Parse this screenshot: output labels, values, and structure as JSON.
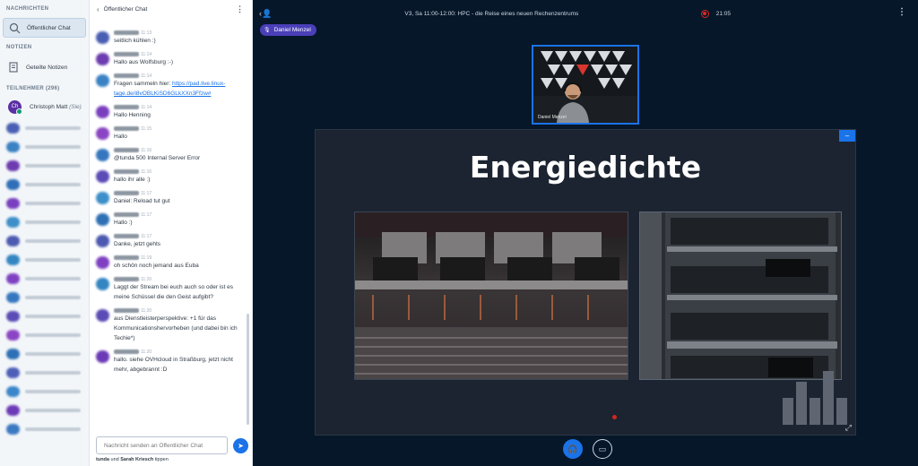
{
  "sidebar": {
    "messages_heading": "NACHRICHTEN",
    "public_chat": "Öffentlicher Chat",
    "notes_heading": "NOTIZEN",
    "shared_notes": "Geteilte Notizen",
    "participants_heading": "TEILNEHMER (296)",
    "me": {
      "initials": "Ch",
      "name": "Christoph Matt",
      "suffix": "(Sie)"
    },
    "blurred_colors": [
      "#4a5fb3",
      "#3a82c4",
      "#6c3cb0",
      "#2f6fb8",
      "#7a3fbf",
      "#3c8fc9",
      "#4b5ab0",
      "#3386c2",
      "#7f41c2",
      "#3577bf",
      "#5a4bb6",
      "#8a45c4",
      "#2e70b5",
      "#4e5fb8",
      "#3a86c9",
      "#6b3ab6",
      "#3b79c0"
    ]
  },
  "chat": {
    "title": "Öffentlicher Chat",
    "input_placeholder": "Nachricht senden an Öffentlicher Chat",
    "typing_user1": "tunda",
    "typing_and": "und",
    "typing_user2": "Sarah Kriesch",
    "typing_suffix": "tippen",
    "messages": [
      {
        "time": "11:13",
        "text": "seitlich kühlen :)",
        "color": "#4a5fb3"
      },
      {
        "time": "11:14",
        "text": "Hallo aus Wolfsburg :-)",
        "color": "#6c3cb0"
      },
      {
        "time": "11:14",
        "text": "Fragen sammeln hier: ",
        "link": "https://pad.live.linux-tage.de/i8vOBLKiSD6GLkXXn3Ffzw#",
        "color": "#3a82c4"
      },
      {
        "time": "11:14",
        "text": "Hallo Henning",
        "color": "#7a3fbf"
      },
      {
        "time": "11:15",
        "text": "Hallo",
        "color": "#8a45c4"
      },
      {
        "time": "11:16",
        "text": "@tunda 500 Internal Server Error",
        "color": "#3577bf"
      },
      {
        "time": "11:16",
        "text": "hallo ihr alle :)",
        "color": "#5a4bb6"
      },
      {
        "time": "11:17",
        "text": "Daniel: Reload tut gut",
        "color": "#3c8fc9"
      },
      {
        "time": "11:17",
        "text": "Hallo :)",
        "color": "#2e70b5"
      },
      {
        "time": "11:17",
        "text": "Danke, jetzt gehts",
        "color": "#4b5ab0"
      },
      {
        "time": "11:19",
        "text": "oh schön noch jemand aus Euba",
        "color": "#7f41c2"
      },
      {
        "time": "11:20",
        "text": "Laggt der Stream bei euch auch so oder ist es meine Schüssel die den Geist aufgibt?",
        "color": "#3386c2"
      },
      {
        "time": "11:20",
        "text": "aus Dienstleisterperspektive: +1 für das Kommunicationshervorheben (und dabei bin ich Techie*)",
        "color": "#5a4bb6"
      },
      {
        "time": "11:20",
        "text": "hallo. siehe OVHcloud in Straßburg, jetzt nicht mehr, abgebrannt :D",
        "color": "#6b3ab6"
      }
    ]
  },
  "topbar": {
    "title": "V3, Sa 11:00-12:00: HPC - die Reise eines neuen Rechenzentrums",
    "rec_time": "21:05"
  },
  "talker": {
    "name": "Daniel Menzel"
  },
  "webcam": {
    "name": "Daniel Menzel"
  },
  "presentation": {
    "slide_title": "Energiedichte"
  }
}
